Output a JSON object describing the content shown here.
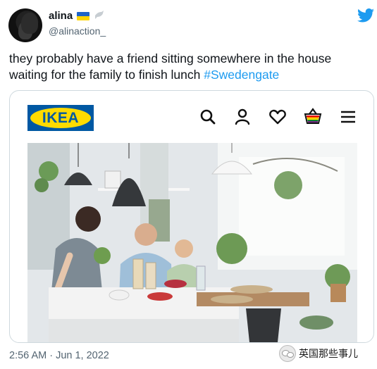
{
  "tweet": {
    "display_name": "alina",
    "handle": "@alinaction_",
    "text_before": "they probably have a friend sitting somewhere in the house waiting for the family to finish lunch ",
    "hashtag": "#Swedengate",
    "timestamp": "2:56 AM · Jun 1, 2022",
    "emoji_flag": "ukraine-flag",
    "emoji_dove": "dove-icon"
  },
  "card": {
    "logo_text": "IKEA",
    "nav_icons": [
      "search-icon",
      "account-icon",
      "heart-icon",
      "basket-icon",
      "menu-icon"
    ],
    "image": "family-kitchen-photo"
  },
  "watermark": {
    "text": "英国那些事儿"
  },
  "colors": {
    "link": "#1d9bf0",
    "twitter_bird": "#1d9bf0",
    "ikea_blue": "#0058a3",
    "ikea_yellow": "#ffdb00",
    "muted": "#536471"
  }
}
